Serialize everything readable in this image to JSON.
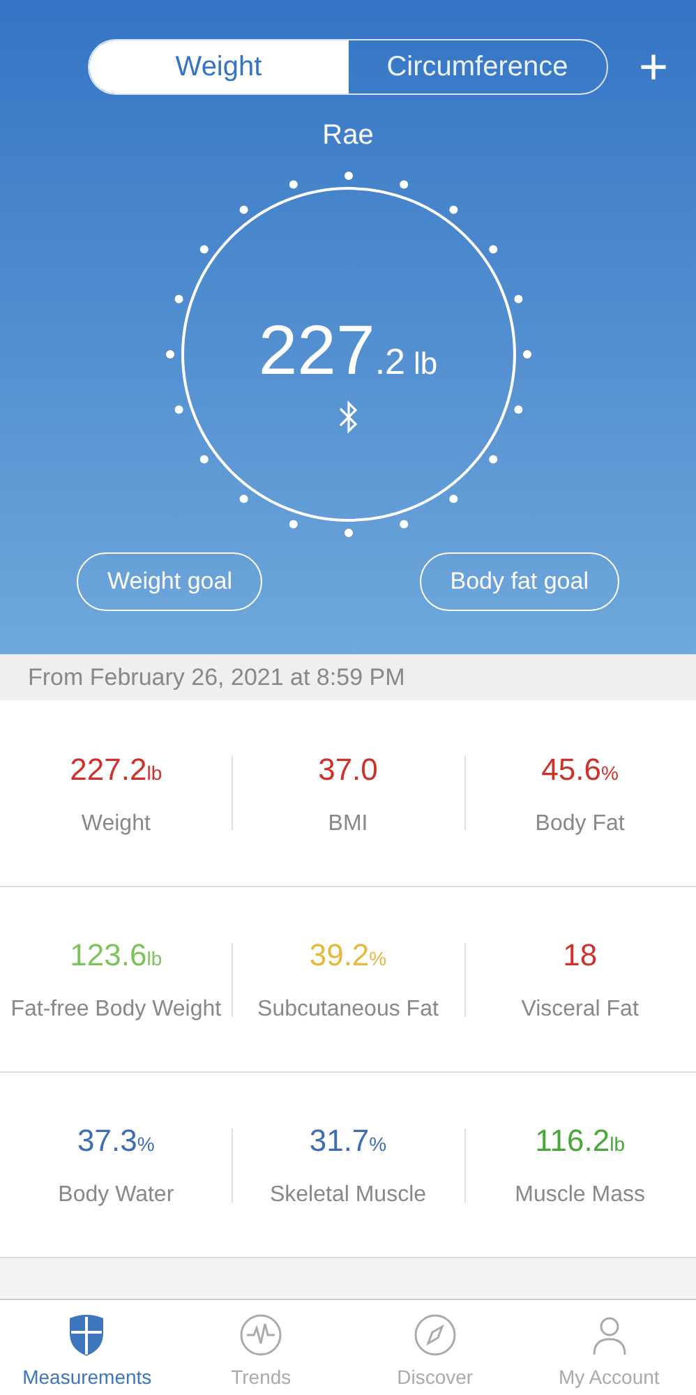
{
  "segments": [
    {
      "label": "Weight",
      "selected": true
    },
    {
      "label": "Circumference",
      "selected": false
    }
  ],
  "add_button": "+",
  "user": "Rae",
  "reading": {
    "value": "227",
    "decimal": ".2",
    "unit": "lb"
  },
  "goal_buttons": [
    "Weight goal",
    "Body fat goal"
  ],
  "date_label": "From February 26, 2021 at 8:59 PM",
  "metrics": [
    {
      "value": "227.2",
      "unit": "lb",
      "label": "Weight",
      "color": "#d0302c"
    },
    {
      "value": "37.0",
      "label": "BMI",
      "color": "#d0302c"
    },
    {
      "value": "45.6",
      "unit": "%",
      "label": "Body Fat",
      "color": "#d0302c"
    },
    {
      "value": "123.6",
      "unit": "lb",
      "label": "Fat-free Body Weight",
      "color": "#7cc35c"
    },
    {
      "value": "39.2",
      "unit": "%",
      "label": "Subcutaneous Fat",
      "color": "#e6b83b"
    },
    {
      "value": "18",
      "label": "Visceral Fat",
      "color": "#d0302c"
    },
    {
      "value": "37.3",
      "unit": "%",
      "label": "Body Water",
      "color": "#3d6db3"
    },
    {
      "value": "31.7",
      "unit": "%",
      "label": "Skeletal Muscle",
      "color": "#3d6db3"
    },
    {
      "value": "116.2",
      "unit": "lb",
      "label": "Muscle Mass",
      "color": "#4aa63a"
    }
  ],
  "tab_bar": [
    {
      "label": "Measurements",
      "selected": true,
      "kind": "shield"
    },
    {
      "label": "Trends",
      "selected": false,
      "kind": "pulse"
    },
    {
      "label": "Discover",
      "selected": false,
      "kind": "compass"
    },
    {
      "label": "My Account",
      "selected": false,
      "kind": "person"
    }
  ]
}
